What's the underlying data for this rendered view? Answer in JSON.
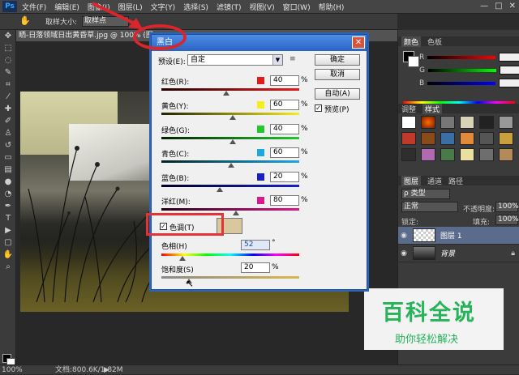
{
  "menu": {
    "logo": "Ps",
    "items": [
      "文件(F)",
      "编辑(E)",
      "图像(I)",
      "图层(L)",
      "文字(Y)",
      "选择(S)",
      "滤镜(T)",
      "视图(V)",
      "窗口(W)",
      "帮助(H)"
    ],
    "window_controls": [
      "—",
      "□",
      "✕"
    ]
  },
  "options_bar": {
    "tool_icon": "hand-icon",
    "sample_label": "取样大小:",
    "sample_value": "取样点"
  },
  "document": {
    "tab_title": "晒-日落领域日出黄昏草.jpg @ 100% (图..."
  },
  "status_bar": {
    "zoom": "100%",
    "doc_size": "文档:800.6K/1.82M",
    "arrow": "▶"
  },
  "right_panel": {
    "color_tabs": [
      "颜色",
      "色板"
    ],
    "rgb_labels": [
      "R",
      "G",
      "B"
    ],
    "style_tabs": [
      "调整",
      "样式"
    ],
    "layers_tabs": [
      "图层",
      "通道",
      "路径"
    ],
    "kind_label": "ρ 类型",
    "blend_mode": "正常",
    "opacity_label": "不透明度:",
    "opacity_value": "100%",
    "lock_label": "锁定:",
    "fill_label": "填充:",
    "fill_value": "100%",
    "layers": [
      {
        "name": "图层 1",
        "selected": true
      },
      {
        "name": "背景",
        "selected": false
      }
    ]
  },
  "dialog": {
    "title": "黑白",
    "close": "✕",
    "preset_label": "预设(E):",
    "preset_value": "自定",
    "preset_menu_icon": "≡",
    "buttons": {
      "ok": "确定",
      "cancel": "取消",
      "auto": "自动(A)"
    },
    "preview_label": "预览(P)",
    "preview_checked": true,
    "sliders": [
      {
        "label": "红色(R):",
        "value": "40",
        "unit": "%",
        "color": "#e21c1c",
        "position": 0.6
      },
      {
        "label": "黄色(Y):",
        "value": "60",
        "unit": "%",
        "color": "#f6ee1a",
        "position": 0.56
      },
      {
        "label": "绿色(G):",
        "value": "40",
        "unit": "%",
        "color": "#23c82c",
        "position": 0.57
      },
      {
        "label": "青色(C):",
        "value": "60",
        "unit": "%",
        "color": "#1ca9e2",
        "position": 0.54
      },
      {
        "label": "蓝色(B):",
        "value": "20",
        "unit": "%",
        "color": "#1820c8",
        "position": 0.44
      },
      {
        "label": "洋红(M):",
        "value": "80",
        "unit": "%",
        "color": "#d81a8a",
        "position": 0.6
      }
    ],
    "tint_label": "色调(T)",
    "tint_checked": true,
    "tint_color": "#d9c79e",
    "hue_label": "色相(H)",
    "hue_value": "52",
    "hue_unit": "°",
    "saturation_label": "饱和度(S)",
    "saturation_value": "20",
    "saturation_unit": "%"
  },
  "watermark": {
    "main": "百科全说",
    "sub": "助你轻松解决"
  }
}
